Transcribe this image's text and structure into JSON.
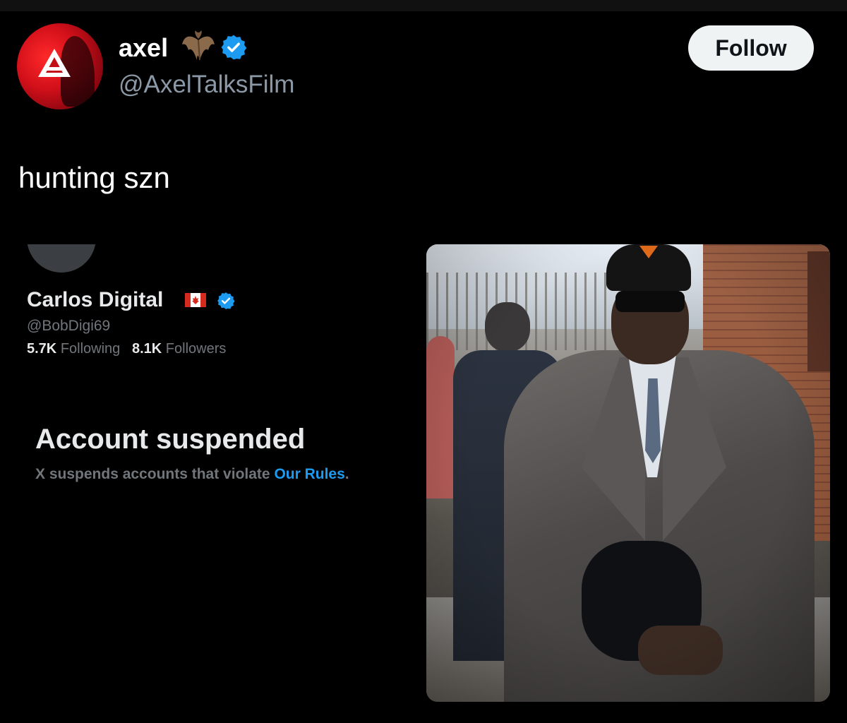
{
  "post": {
    "author_name": "axel",
    "author_handle": "@AxelTalksFilm",
    "follow_label": "Follow",
    "text": "hunting szn"
  },
  "embedded_profile": {
    "name": "Carlos Digital",
    "handle": "@BobDigi69",
    "following_count": "5.7K",
    "following_label": "Following",
    "followers_count": "8.1K",
    "followers_label": "Followers",
    "suspended_title": "Account suspended",
    "suspended_text": "X suspends accounts that violate",
    "rules_link": "Our Rules",
    "rules_period": "."
  },
  "colors": {
    "background": "#000000",
    "accent_blue": "#1d9bf0",
    "muted_text": "#71767b",
    "avatar_red": "#d4101a"
  },
  "icons": [
    "bat-emoji-icon",
    "verified-badge-icon",
    "canada-flag-icon",
    "brand-logo-icon"
  ]
}
